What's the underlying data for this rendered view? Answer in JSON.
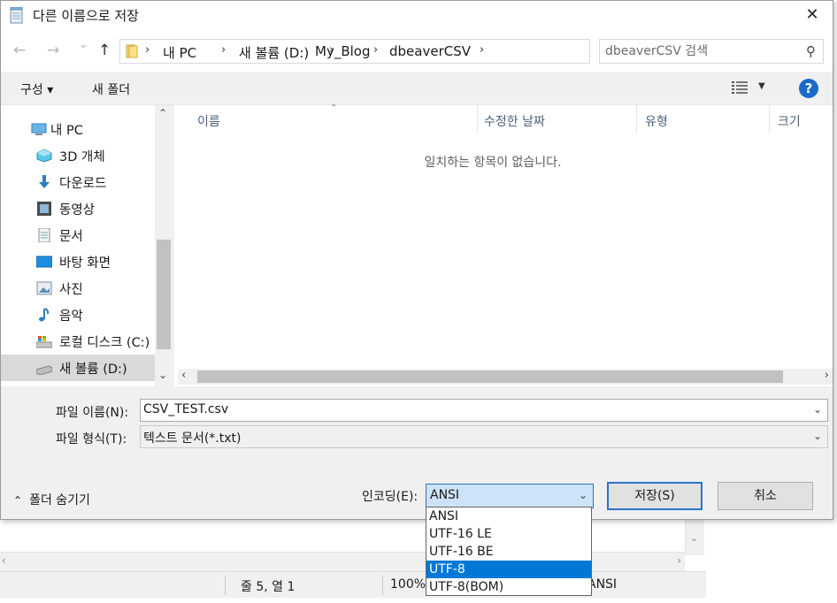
{
  "dialog": {
    "title": "다른 이름으로 저장",
    "close_glyph": "✕"
  },
  "nav": {
    "back_glyph": "←",
    "forward_glyph": "→",
    "recent_glyph": "⌄",
    "up_glyph": "↑",
    "breadcrumbs": [
      "내 PC",
      "새 볼륨 (D:)",
      "My_Blog",
      "dbeaverCSV"
    ],
    "crumb_sep": "›",
    "refresh_glyph": "↻",
    "search_placeholder": "dbeaverCSV 검색"
  },
  "toolbar": {
    "organize": "구성 ▾",
    "new_folder": "새 폴더",
    "help": "?"
  },
  "sidebar": {
    "items": [
      {
        "label": "내 PC",
        "icon": "pc-icon"
      },
      {
        "label": "3D 개체",
        "icon": "cube-icon"
      },
      {
        "label": "다운로드",
        "icon": "download-icon"
      },
      {
        "label": "동영상",
        "icon": "video-icon"
      },
      {
        "label": "문서",
        "icon": "document-icon"
      },
      {
        "label": "바탕 화면",
        "icon": "desktop-icon"
      },
      {
        "label": "사진",
        "icon": "pictures-icon"
      },
      {
        "label": "음악",
        "icon": "music-icon"
      },
      {
        "label": "로컬 디스크 (C:)",
        "icon": "drive-c-icon"
      },
      {
        "label": "새 볼륨 (D:)",
        "icon": "drive-d-icon",
        "selected": true
      }
    ]
  },
  "file_list": {
    "columns": [
      "이름",
      "수정한 날짜",
      "유형",
      "크기"
    ],
    "empty_message": "일치하는 항목이 없습니다."
  },
  "form": {
    "filename_label": "파일 이름(N):",
    "filename_value": "CSV_TEST.csv",
    "filetype_label": "파일 형식(T):",
    "filetype_value": "텍스트 문서(*.txt)",
    "hide_folders": "폴더 숨기기",
    "encoding_label": "인코딩(E):",
    "encoding_value": "ANSI",
    "encoding_options": [
      "ANSI",
      "UTF-16 LE",
      "UTF-16 BE",
      "UTF-8",
      "UTF-8(BOM)"
    ],
    "encoding_highlighted": "UTF-8",
    "save_label": "저장(S)",
    "cancel_label": "취소"
  },
  "background_window": {
    "status_position": "줄 5, 열 1",
    "status_zoom": "100%",
    "status_encoding": "ANSI"
  },
  "colors": {
    "accent": "#0078d7",
    "help_blue": "#1b6ac9",
    "selected_bg": "#d9d9d9"
  }
}
